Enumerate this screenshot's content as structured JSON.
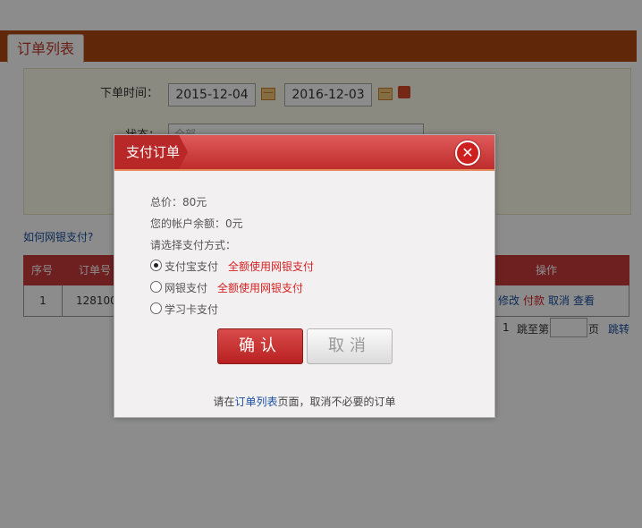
{
  "page": {
    "tab_label": "订单列表",
    "filter": {
      "order_time_label": "下单时间：",
      "start_date": "2015-12-04",
      "end_date": "2016-12-03",
      "status_label": "状态：",
      "status_value": "全部"
    },
    "help_link": "如何网银支付?",
    "table": {
      "headers": [
        "序号",
        "订单号",
        "操作"
      ],
      "rows": [
        {
          "index": "1",
          "order_no": "128100",
          "actions": [
            "修改",
            "付款",
            "取消",
            "查看"
          ]
        }
      ]
    },
    "pager": {
      "current": "1",
      "jump_prefix": "跳至第",
      "jump_suffix": "页",
      "jump_button": "跳转"
    }
  },
  "dialog": {
    "title": "支付订单",
    "close_icon": "close-icon",
    "total": "总价：80元",
    "balance": "您的帐户余额：0元",
    "choose": "请选择支付方式：",
    "options": [
      {
        "label": "支付宝支付",
        "note": "全额使用网银支付",
        "selected": true
      },
      {
        "label": "网银支付",
        "note": "全额使用网银支付",
        "selected": false
      },
      {
        "label": "学习卡支付",
        "note": "",
        "selected": false
      }
    ],
    "confirm_label": "确认",
    "cancel_label": "取消",
    "footer_prefix": "请在",
    "footer_link": "订单列表",
    "footer_suffix": "页面，取消不必要的订单"
  },
  "colors": {
    "accent_red": "#c93b3b",
    "topbar_brown": "#b04a12",
    "link_blue": "#1a4fa0",
    "note_red": "#d42222"
  }
}
